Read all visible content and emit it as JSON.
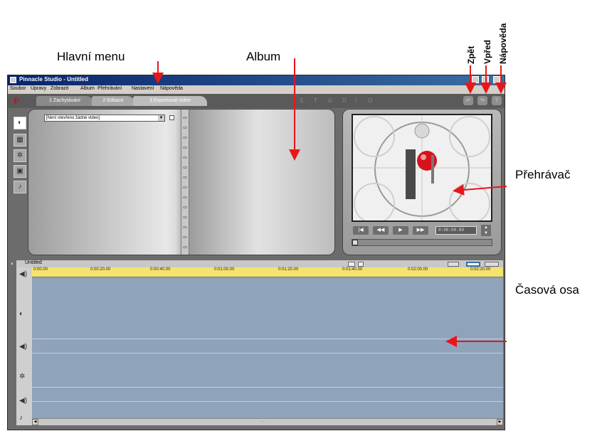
{
  "annotations": {
    "main_menu": "Hlavní menu",
    "album": "Album",
    "player": "Přehrávač",
    "timeline": "Časová osa",
    "back": "Zpět",
    "forward": "Vpřed",
    "help": "Nápověda"
  },
  "app": {
    "title": "Pinnacle Studio - Untitled",
    "menu": [
      "Soubor",
      "Úpravy",
      "Zobrazit",
      "Album",
      "Přehrávání",
      "Nastavení",
      "Nápověda"
    ],
    "tabs": [
      "1 Zachytávání",
      "2 Editace",
      "3 Exportovat video"
    ],
    "studio_letters": [
      "S",
      "T",
      "U",
      "D",
      "I",
      "O"
    ],
    "top_buttons": [
      "↶",
      "↷",
      "?"
    ]
  },
  "album": {
    "select_value": "[Není otevřeno žádné video]"
  },
  "player": {
    "buttons": [
      "|◀",
      "◀◀",
      "▶",
      "▶▶"
    ],
    "timecode": "0:00:00.00"
  },
  "timeline": {
    "project_name": "Untitled",
    "ruler_ticks": [
      "0:00.00",
      "0:00:20.00",
      "0:00:40.00",
      "0:01:00.00",
      "0:01:20.00",
      "0:01:40.00",
      "0:02:00.00",
      "0:02:20.00"
    ]
  },
  "colors": {
    "arrow": "#e8161c",
    "timeline_tracks": "#8fa3bb",
    "ruler": "#f4e36e"
  }
}
